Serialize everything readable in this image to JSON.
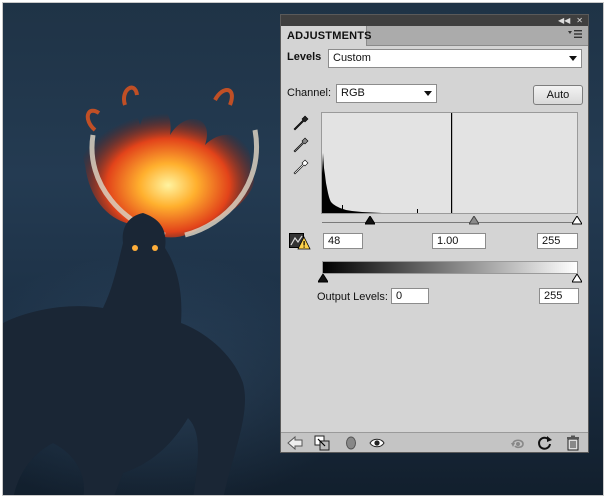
{
  "panel": {
    "tab_title": "ADJUSTMENTS",
    "collapse_icon": "double-chevron-icon",
    "close_icon": "close-icon",
    "menu_icon": "panel-menu-icon"
  },
  "levels": {
    "label": "Levels",
    "preset_value": "Custom"
  },
  "channel": {
    "label": "Channel:",
    "value": "RGB"
  },
  "auto_button": "Auto",
  "input_levels": {
    "black": "48",
    "gamma": "1.00",
    "white": "255"
  },
  "output_levels": {
    "label": "Output Levels:",
    "black": "0",
    "white": "255"
  },
  "colors": {
    "panel_bg": "#d4d4d4",
    "tab_bar": "#ababab",
    "top_bar": "#3f3f3f"
  }
}
